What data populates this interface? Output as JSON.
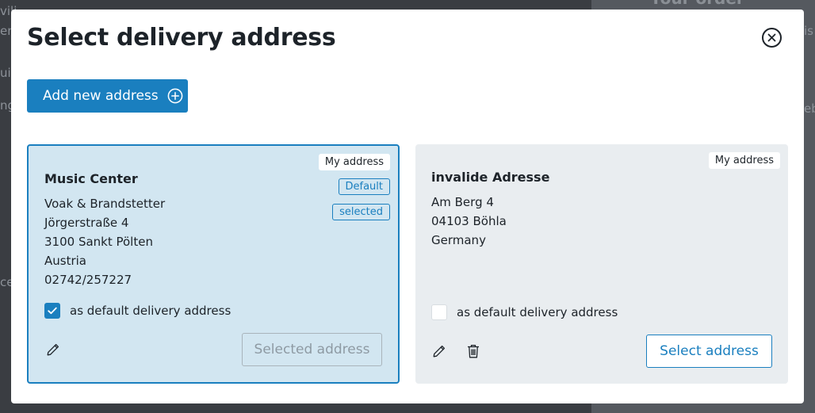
{
  "background": {
    "right_heading": "Your order overview",
    "fragments": [
      "vili",
      "en",
      "uip",
      "ng",
      "is",
      "eb",
      "cel"
    ]
  },
  "modal": {
    "title": "Select delivery address",
    "close_icon": "close-circle-icon",
    "add_button": {
      "label": "Add new address",
      "icon": "plus-circle-icon"
    }
  },
  "addresses": [
    {
      "tag": "My address",
      "badges": [
        "Default",
        "selected"
      ],
      "name": "Music Center",
      "lines": [
        "Voak & Brandstetter",
        "Jörgerstraße 4",
        "3100 Sankt Pölten",
        "Austria",
        "02742/257227"
      ],
      "default_checkbox": {
        "label": "as default delivery address",
        "checked": true
      },
      "action_label": "Selected address",
      "action_disabled": true,
      "icons": [
        "pencil-icon"
      ]
    },
    {
      "tag": "My address",
      "badges": [],
      "name": "invalide Adresse",
      "lines": [
        "Am Berg 4",
        "04103 Böhla",
        "Germany"
      ],
      "default_checkbox": {
        "label": "as default delivery address",
        "checked": false
      },
      "action_label": "Select address",
      "action_disabled": false,
      "icons": [
        "pencil-icon",
        "trash-icon"
      ]
    }
  ],
  "colors": {
    "primary": "#1a7fbf",
    "selected_card": "#d2e6f1",
    "card": "#e9edf0"
  }
}
